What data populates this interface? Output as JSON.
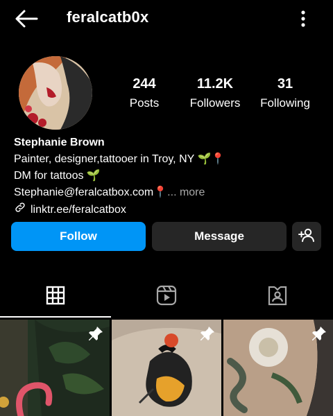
{
  "header": {
    "username": "feralcatb0x"
  },
  "profile": {
    "stats": [
      {
        "value": "244",
        "label": "Posts"
      },
      {
        "value": "11.2K",
        "label": "Followers"
      },
      {
        "value": "31",
        "label": "Following"
      }
    ],
    "name": "Stephanie Brown",
    "bio_line1": "Painter, designer,tattooer in Troy, NY 🌱📍",
    "bio_line2": " DM for tattoos 🌱",
    "bio_line3": "Stephanie@feralcatbox.com📍",
    "more": "... more",
    "link": "linktr.ee/feralcatbox"
  },
  "actions": {
    "follow": "Follow",
    "message": "Message"
  },
  "tabs": [
    "grid-posts",
    "reels",
    "tagged"
  ],
  "colors": {
    "accent": "#0095f6",
    "button_dark": "#262626",
    "muted": "#a8a8a8"
  },
  "icons": [
    "back-arrow-icon",
    "more-options-icon",
    "add-user-icon",
    "grid-icon",
    "reels-icon",
    "tagged-icon",
    "pin-icon",
    "link-icon"
  ]
}
